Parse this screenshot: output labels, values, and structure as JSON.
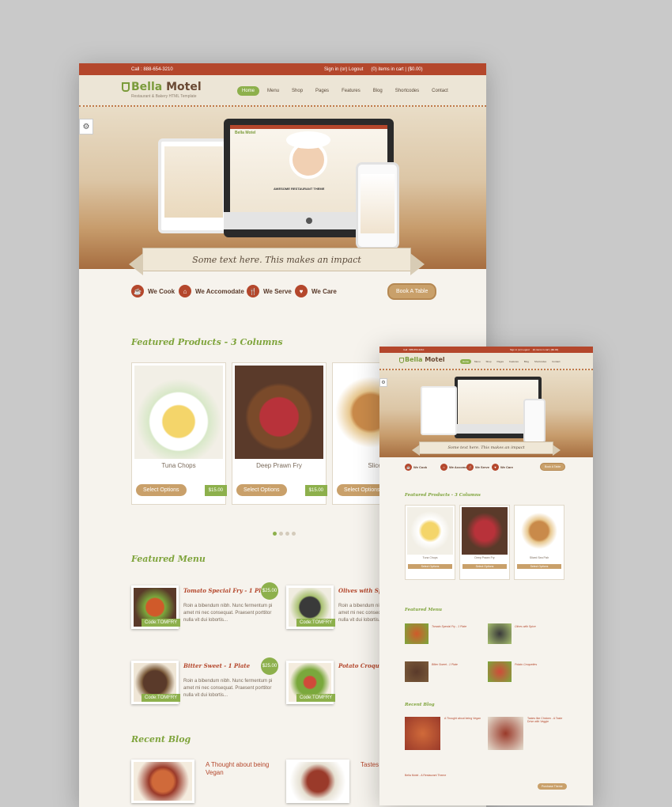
{
  "site": {
    "phone_label": "Call : 888-654-3210",
    "signin_label": "Sign in (or) Logout",
    "cart_label": "(0) items in cart | ($0.00)",
    "logo_first": "Bella",
    "logo_second": "Motel",
    "tagline": "Restaurant & Bakery HTML Template",
    "gear_icon": "⚙",
    "nav": [
      "Home",
      "Menu",
      "Shop",
      "Pages",
      "Features",
      "Blog",
      "Shortcodes",
      "Contact"
    ],
    "hero_ribbon": "Some text here. This makes an impact",
    "screen_title": "Bella Motel",
    "screen_banner": "AWESOME RESTAURANT THEME"
  },
  "services": {
    "items": [
      {
        "label": "We Cook",
        "icon": "☕"
      },
      {
        "label": "We Accomodate",
        "icon": "⌂"
      },
      {
        "label": "We Serve",
        "icon": "🍴"
      },
      {
        "label": "We Care",
        "icon": "♥"
      }
    ],
    "book_label": "Book A Table"
  },
  "featured_products": {
    "title": "Featured Products - 3 Columns",
    "items": [
      {
        "name": "Tuna Chops",
        "price": "$15.00",
        "option": "Select Options",
        "color": "#f4d56a"
      },
      {
        "name": "Deep Prawn Fry",
        "price": "$15.00",
        "option": "Select Options",
        "color": "#b8323a"
      },
      {
        "name": "Sliced Sea Fish",
        "price": "$15.00",
        "option": "Select Options",
        "color": "#c98a4a"
      }
    ],
    "big_visible_names": [
      "Tuna Chops",
      "Deep Prawn Fry",
      "Sliced S"
    ]
  },
  "featured_menu": {
    "title": "Featured Menu",
    "desc": "Roin a bibendum nibh. Nunc fermentum pi amet mi nec consequat. Praesent porttitor nulla vit dui lobortis...",
    "items": [
      {
        "title": "Tomato Special Fry - 1 Plate",
        "price": "$25.00",
        "code": "Code:TOMFRY",
        "color": "#d05a2a"
      },
      {
        "title": "Olives with Spice",
        "price": "$25.00",
        "code": "Code:TOMFRY",
        "color": "#3a3a3a"
      },
      {
        "title": "Bitter Sweet - 1 Plate",
        "price": "$25.00",
        "code": "Code:TOMFRY",
        "color": "#5a3a2a"
      },
      {
        "title": "Potato Croquettes",
        "price": "$25.00",
        "code": "Code:TOMFRY",
        "color": "#7aa83c"
      }
    ],
    "big_visible_titles": [
      "Tomato Special Fry - 1 Plate",
      "Olives with Spic",
      "Bitter Sweet - 1 Plate",
      "Potato Croquette"
    ]
  },
  "recent_blog": {
    "title": "Recent Blog",
    "items": [
      {
        "title": "A Thought about being Vegan",
        "color": "#d06a3a"
      },
      {
        "title": "Tastes like Chicken - A Taste Drive with Veggie",
        "color": "#9a3a2a"
      }
    ],
    "big_visible_titles": [
      "A Thought about being Vegan",
      "Tastes Drive w"
    ],
    "small_footer_title": "Bella Motel - A Restaurant Theme",
    "small_footer_button": "Purchase Theme"
  }
}
